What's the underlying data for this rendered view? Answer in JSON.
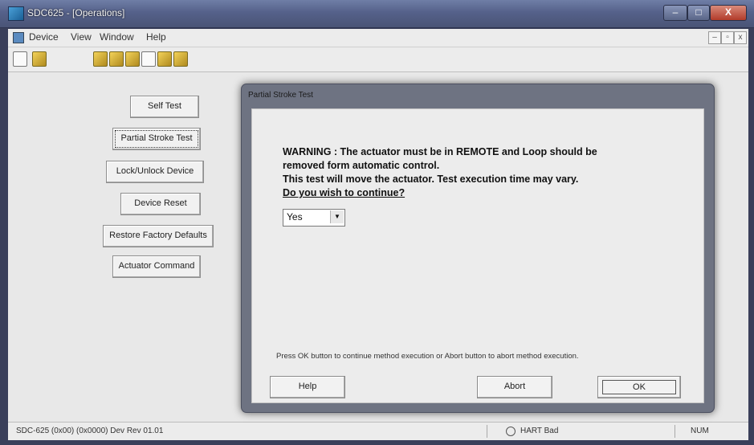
{
  "window": {
    "title": "SDC625 - [Operations]",
    "minimize": "–",
    "maximize": "□",
    "close": "X"
  },
  "menu": {
    "items": [
      "Device",
      "View",
      "Window",
      "Help"
    ],
    "mdi_controls": [
      "–",
      "▫",
      "x"
    ]
  },
  "toolbar": {
    "icons": [
      "new-doc-icon",
      "open-icon",
      "connect-icon",
      "device-icon",
      "refresh-icon",
      "save-icon",
      "export-icon",
      "import-icon"
    ]
  },
  "side_buttons": [
    "Self Test",
    "Partial Stroke Test",
    "Lock/Unlock Device",
    "Device Reset",
    "Restore Factory Defaults",
    "Actuator Command"
  ],
  "dialog": {
    "title": "Partial Stroke Test",
    "warning_line1": "WARNING : The actuator must be in REMOTE and Loop should be",
    "warning_line2": "removed form automatic control.",
    "warning_line3": "This test will move the actuator. Test execution time may vary.",
    "question": "Do you wish to continue?",
    "select_value": "Yes",
    "info": "Press OK button to continue method execution or Abort button to abort method execution.",
    "help_label": "Help",
    "abort_label": "Abort",
    "ok_label": "OK"
  },
  "status": {
    "left": "SDC-625  (0x00) (0x0000) Dev Rev 01.01",
    "hart": "HART Bad",
    "num": "NUM"
  },
  "colors": {
    "titlebar": "#55618a",
    "dialog_frame": "#6e7382",
    "client": "#e8e8e8"
  }
}
